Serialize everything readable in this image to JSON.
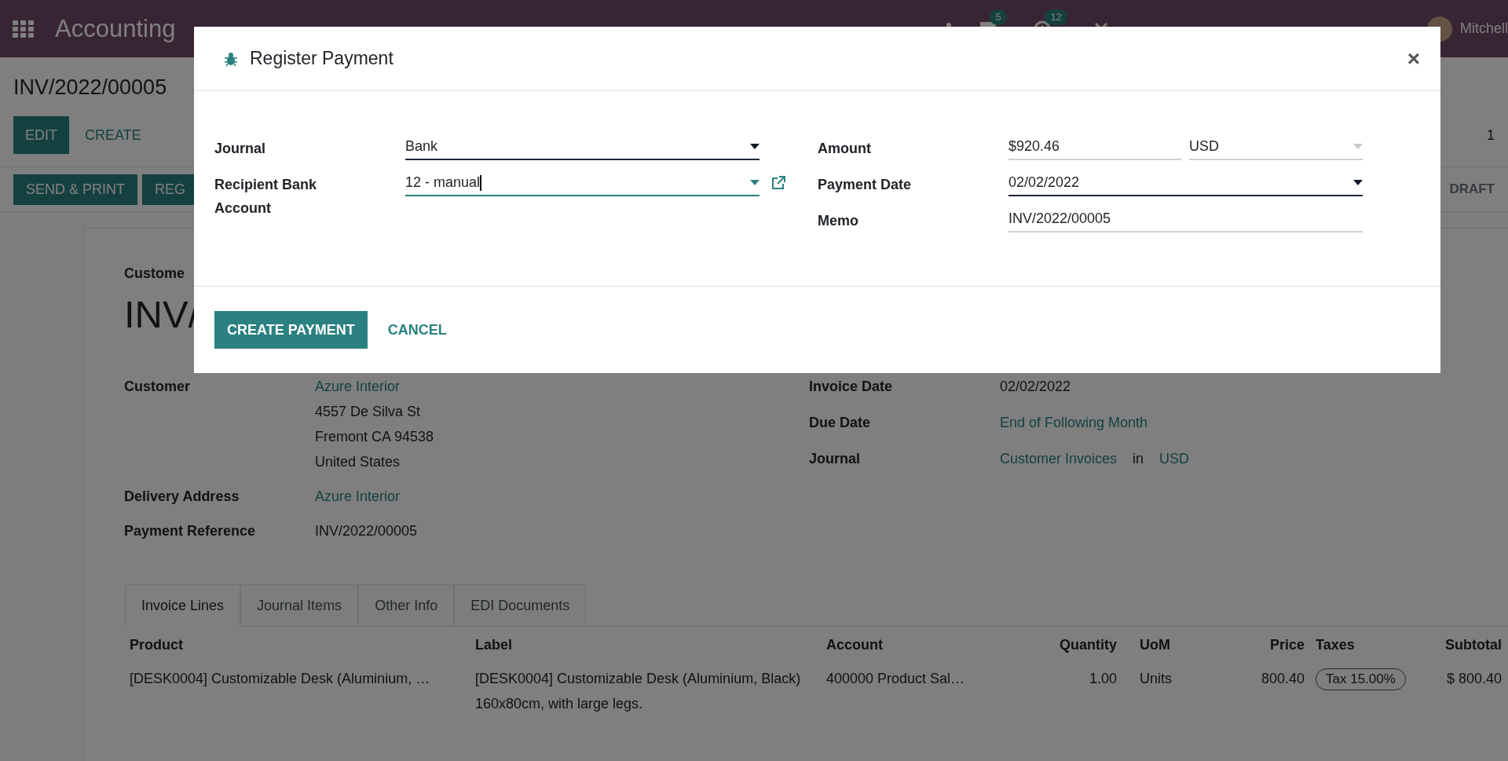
{
  "navbar": {
    "app_name": "Accounting",
    "messages_badge": "5",
    "activities_badge": "12",
    "user": "Mitchell"
  },
  "control_panel": {
    "title": "INV/2022/00005",
    "buttons": [
      {
        "label": "EDIT",
        "kind": "primary"
      },
      {
        "label": "CREATE",
        "kind": "link"
      }
    ],
    "pager": "1"
  },
  "status_bar": {
    "buttons": [
      "SEND & PRINT",
      "REG"
    ],
    "status": "DRAFT"
  },
  "sheet": {
    "partner_label": "Custome",
    "number": "INV/",
    "left_fields": [
      {
        "label": "Customer",
        "values": [
          {
            "text": "Azure Interior",
            "link": true
          },
          {
            "text": "4557 De Silva St",
            "link": false
          },
          {
            "text": "Fremont CA 94538",
            "link": false
          },
          {
            "text": "United States",
            "link": false
          }
        ]
      },
      {
        "label": "Delivery Address",
        "values": [
          {
            "text": "Azure Interior",
            "link": true
          }
        ]
      },
      {
        "label": "Payment Reference",
        "values": [
          {
            "text": "INV/2022/00005",
            "link": false
          }
        ]
      }
    ],
    "right_fields": [
      {
        "label": "Invoice Date",
        "values": [
          {
            "text": "02/02/2022",
            "link": false
          }
        ]
      },
      {
        "label": "Due Date",
        "values": [
          {
            "text": "End of Following Month",
            "link": true
          }
        ]
      },
      {
        "label": "Journal",
        "values": [
          {
            "text": "Customer Invoices",
            "link": true
          },
          {
            "text": "in",
            "link": false
          },
          {
            "text": "USD",
            "link": true
          }
        ]
      }
    ],
    "tabs": [
      {
        "label": "Invoice Lines",
        "selected": true
      },
      {
        "label": "Journal Items",
        "selected": false
      },
      {
        "label": "Other Info",
        "selected": false
      },
      {
        "label": "EDI Documents",
        "selected": false
      }
    ],
    "table": {
      "columns": [
        "Product",
        "Label",
        "Account",
        "Quantity",
        "UoM",
        "Price",
        "Taxes",
        "Subtotal"
      ],
      "rows": [
        {
          "product": "[DESK0004] Customizable Desk (Aluminium, …",
          "label": [
            "[DESK0004] Customizable Desk (Aluminium, Black)",
            "160x80cm, with large legs."
          ],
          "account": "400000 Product Sal…",
          "quantity": "1.00",
          "uom": "Units",
          "price": "800.40",
          "taxes": [
            "Tax 15.00%"
          ],
          "subtotal": "$ 800.40"
        }
      ]
    }
  },
  "dialog": {
    "title": "Register Payment",
    "close": "×",
    "left_fields": [
      {
        "label": "Journal",
        "value": "Bank",
        "kind": "select",
        "focused": false
      },
      {
        "label": "Recipient Bank Account",
        "value": "12 - manual",
        "kind": "select_link",
        "focused": true
      }
    ],
    "right_fields": [
      {
        "label": "Amount",
        "value": "$920.46",
        "currency": "USD",
        "kind": "amount",
        "focused": false
      },
      {
        "label": "Payment Date",
        "value": "02/02/2022",
        "kind": "select",
        "focused": false
      },
      {
        "label": "Memo",
        "value": "INV/2022/00005",
        "kind": "text",
        "focused": false
      }
    ],
    "buttons": [
      {
        "label": "CREATE PAYMENT",
        "kind": "primary"
      },
      {
        "label": "CANCEL",
        "kind": "link"
      }
    ]
  }
}
